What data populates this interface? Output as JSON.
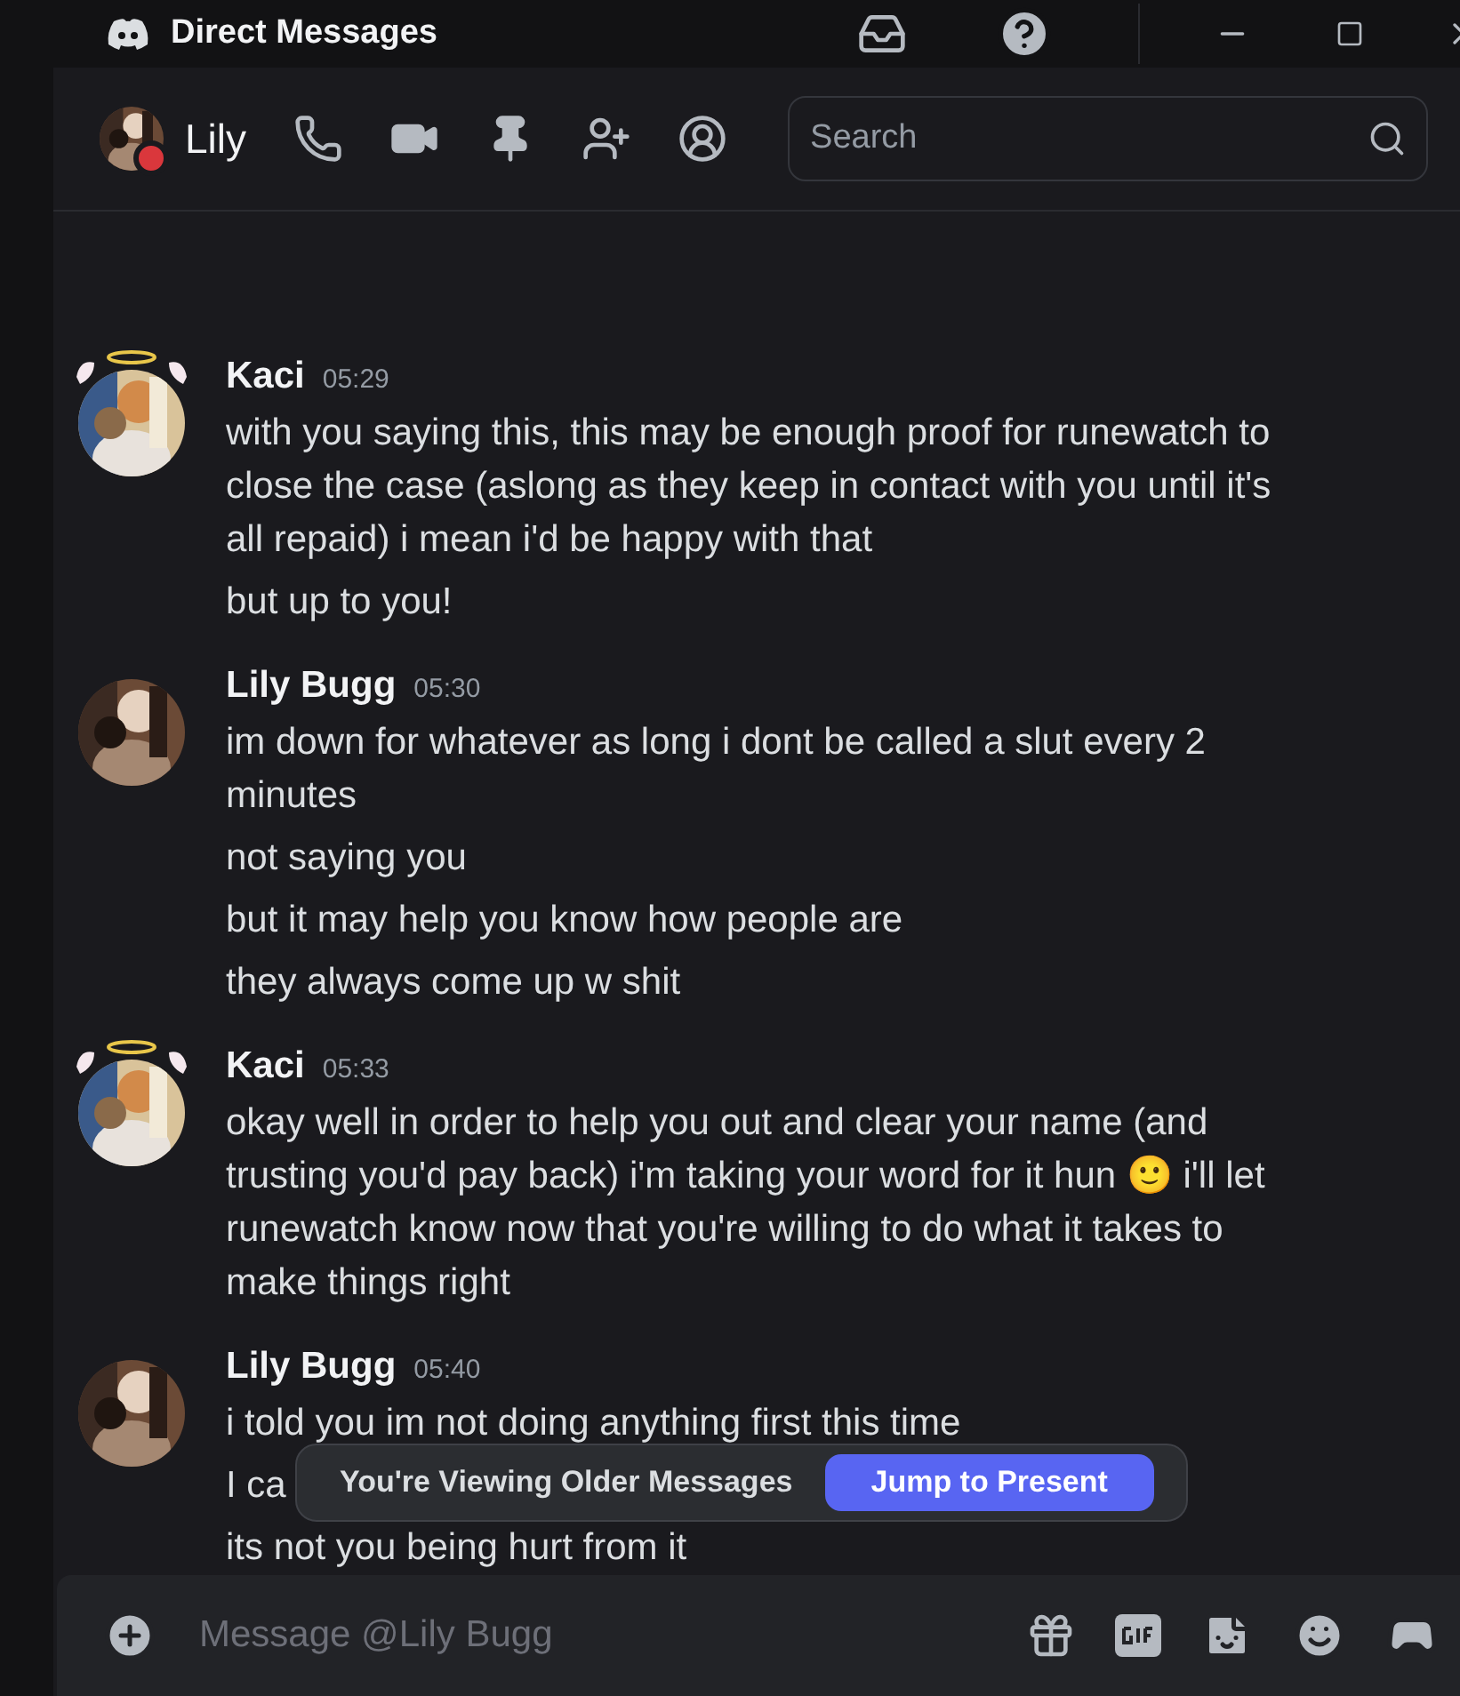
{
  "window": {
    "title": "Direct Messages"
  },
  "header": {
    "name": "Lily",
    "search": {
      "placeholder": "Search"
    }
  },
  "messages": [
    {
      "author": "Kaci",
      "time": "05:29",
      "decorated": true,
      "lines": [
        "with you saying this, this may be enough proof for runewatch to close the case (aslong as they keep in contact with you until it's all repaid) i mean i'd be happy with that",
        "but up to you!"
      ]
    },
    {
      "author": "Lily Bugg",
      "time": "05:30",
      "decorated": false,
      "lines": [
        "im down for whatever as long i dont be called a slut every 2 minutes",
        "not saying you",
        "but it may help you know how people are",
        "they always come up w shit"
      ]
    },
    {
      "author": "Kaci",
      "time": "05:33",
      "decorated": true,
      "lines": [
        "okay well in order to help you out and clear your name (and trusting you'd pay back) i'm taking your word for it hun 🙂 i'll let runewatch know now that you're willing to do what it takes to make things right"
      ]
    },
    {
      "author": "Lily Bugg",
      "time": "05:40",
      "decorated": false,
      "lines": [
        "i told you im not doing anything first this time",
        "I ca",
        "its not you being hurt from it"
      ]
    }
  ],
  "toast": {
    "text": "You're Viewing Older Messages",
    "button": "Jump to Present"
  },
  "composer": {
    "placeholder": "Message @Lily Bugg"
  }
}
